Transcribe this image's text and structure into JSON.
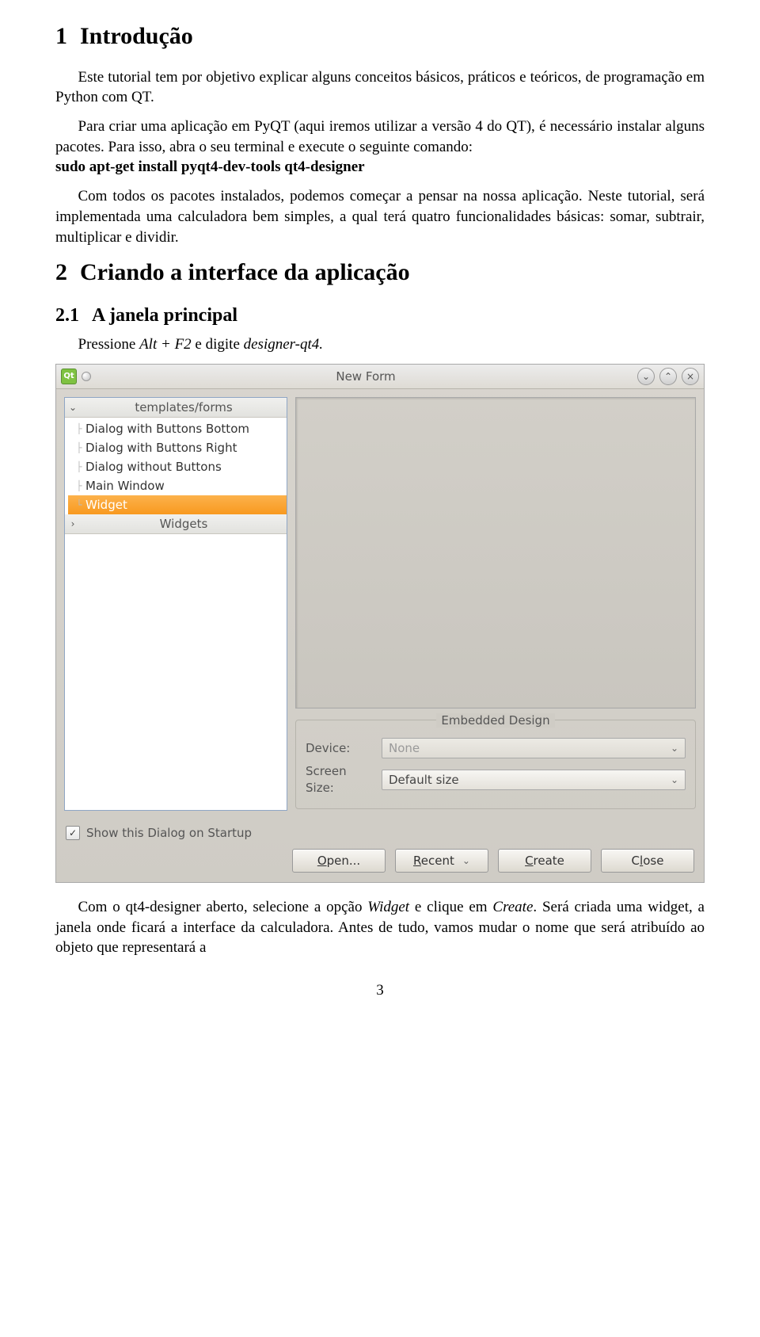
{
  "section1": {
    "number": "1",
    "title": "Introdução",
    "p1": "Este tutorial tem por objetivo explicar alguns conceitos básicos, práticos e teóricos, de programação em Python com QT.",
    "p2a": "Para criar uma aplicação em PyQT (aqui iremos utilizar a versão 4 do QT), é necessário instalar alguns pacotes. Para isso, abra o seu terminal e execute o seguinte comando:",
    "cmd": "sudo apt-get install pyqt4-dev-tools qt4-designer",
    "p3": "Com todos os pacotes instalados, podemos começar a pensar na nossa aplicação. Neste tutorial, será implementada uma calculadora bem simples, a qual terá quatro funcionalidades básicas: somar, subtrair, multiplicar e dividir."
  },
  "section2": {
    "number": "2",
    "title": "Criando a interface da aplicação"
  },
  "subsection21": {
    "number": "2.1",
    "title": "A janela principal",
    "p_a": "Pressione ",
    "p_em": "Alt + F2",
    "p_b": " e digite ",
    "p_em2": "designer-qt4.",
    "after_a": "Com o qt4-designer aberto, selecione a opção ",
    "after_em1": "Widget",
    "after_b": " e clique em ",
    "after_em2": "Create",
    "after_c": ". Será criada uma widget, a janela onde ficará a interface da calculadora. Antes de tudo, vamos mudar o nome que será atribuído ao objeto que representará a"
  },
  "dialog": {
    "title": "New Form",
    "logo_text": "Qt",
    "tree": {
      "header1": "templates/forms",
      "items": [
        "Dialog with Buttons Bottom",
        "Dialog with Buttons Right",
        "Dialog without Buttons",
        "Main Window",
        "Widget"
      ],
      "header2": "Widgets"
    },
    "embedded": {
      "legend": "Embedded Design",
      "device_label": "Device:",
      "device_value": "None",
      "screen_label": "Screen Size:",
      "screen_value": "Default size"
    },
    "checkbox_label": "Show this Dialog on Startup",
    "buttons": {
      "open": "Open...",
      "recent": "Recent",
      "create": "Create",
      "close": "Close"
    }
  },
  "page_number": "3"
}
